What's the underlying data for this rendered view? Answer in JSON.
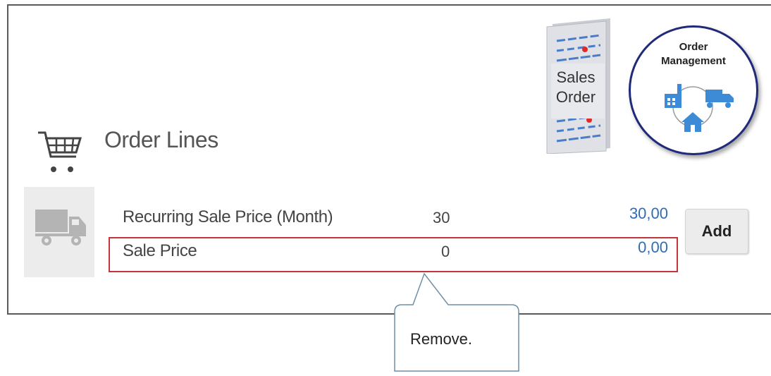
{
  "section": {
    "title": "Order Lines",
    "icon": "shopping-cart-icon"
  },
  "document_icon": {
    "label_line1": "Sales",
    "label_line2": "Order"
  },
  "badge": {
    "label_line1": "Order",
    "label_line2": "Management",
    "ring_color": "#1f2a7a",
    "icon_color": "#3d8ad6"
  },
  "lines": [
    {
      "label": "Recurring Sale Price (Month)",
      "quantity": "30",
      "amount": "30,00"
    },
    {
      "label": "Sale Price",
      "quantity": "0",
      "amount": "0,00"
    }
  ],
  "actions": {
    "add_label": "Add"
  },
  "annotation": {
    "text": "Remove.",
    "highlight_color": "#c2363b"
  },
  "colors": {
    "amount": "#2e6db4",
    "accent": "#3d8ad6"
  }
}
